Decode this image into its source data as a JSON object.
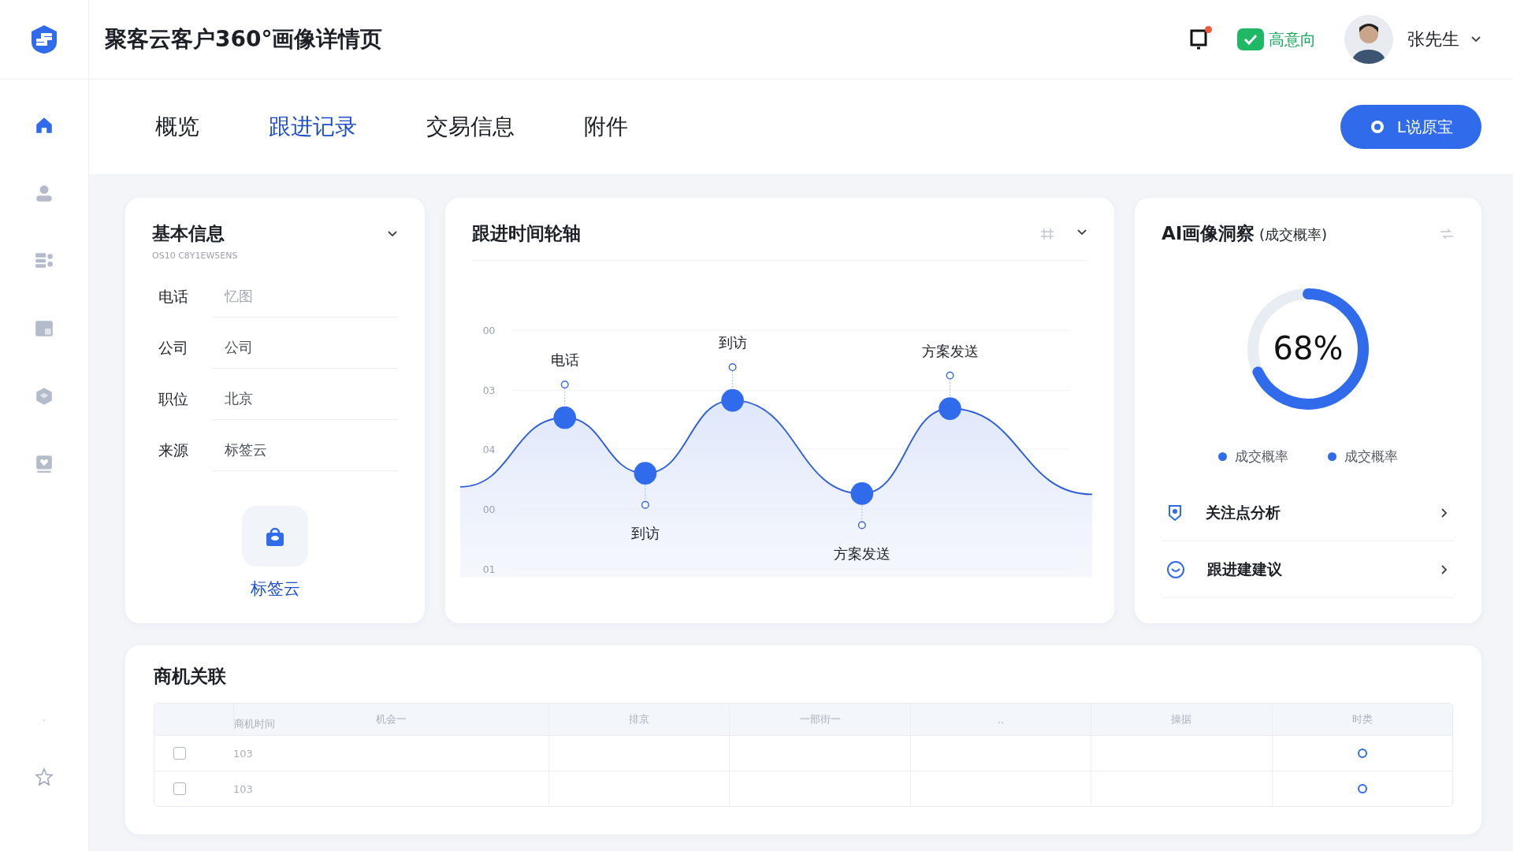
{
  "header": {
    "title": "聚客云客户360°画像详情页",
    "intent_tag": "高意向",
    "user_name": "张先生",
    "notification_unread": true
  },
  "tabs": [
    {
      "label": "概览",
      "selected": false
    },
    {
      "label": "跟进记录",
      "selected": true
    },
    {
      "label": "交易信息",
      "selected": false
    },
    {
      "label": "附件",
      "selected": false
    }
  ],
  "action_button": "L说原宝",
  "sidebar": {
    "items": [
      {
        "kind": "home",
        "selected": true
      },
      {
        "kind": "user",
        "selected": false
      },
      {
        "kind": "list",
        "selected": false
      },
      {
        "kind": "panel",
        "selected": false
      },
      {
        "kind": "box",
        "selected": false
      },
      {
        "kind": "card",
        "selected": false
      }
    ],
    "dot": "·"
  },
  "basic_info": {
    "title": "基本信息",
    "subtitle": "OS10 C8Y1EW5ENS",
    "fields": [
      {
        "label": "电话",
        "placeholder": "忆图"
      },
      {
        "label": "公司",
        "value": "公司"
      },
      {
        "label": "职位",
        "value": "北京"
      },
      {
        "label": "来源",
        "value": "标签云"
      }
    ],
    "tag_cloud_label": "标签云"
  },
  "timeline": {
    "title": "跟进时间轮轴",
    "axis_labels": [
      "00",
      "03",
      "04",
      "00",
      "01"
    ],
    "points": [
      {
        "label": "电话",
        "kind": "peak"
      },
      {
        "label": "到访",
        "kind": "trough"
      },
      {
        "label": "到访",
        "kind": "peak"
      },
      {
        "label": "方案发送",
        "kind": "trough"
      },
      {
        "label": "方案发送",
        "kind": "peak"
      }
    ]
  },
  "ai_insight": {
    "title": "AI画像洞察",
    "subtitle": "(成交概率)",
    "level": 0.68,
    "reading": "68%",
    "legend": [
      {
        "label": "成交概率",
        "color": "#2f6bea"
      },
      {
        "label": "成交概率",
        "color": "#2f6bea"
      }
    ],
    "links": [
      {
        "kind": "focus",
        "label": "关注点分析"
      },
      {
        "kind": "advice",
        "label": "跟进建建议"
      }
    ]
  },
  "opportunities": {
    "title": "商机关联",
    "columns": [
      "商机时间",
      "机会一",
      "排京",
      "一部街一",
      "..",
      "操据",
      "时类"
    ],
    "rows": [
      {
        "checked": false,
        "cells": [
          "103"
        ],
        "status": true
      },
      {
        "checked": false,
        "cells": [
          "103"
        ],
        "status": true
      }
    ]
  }
}
